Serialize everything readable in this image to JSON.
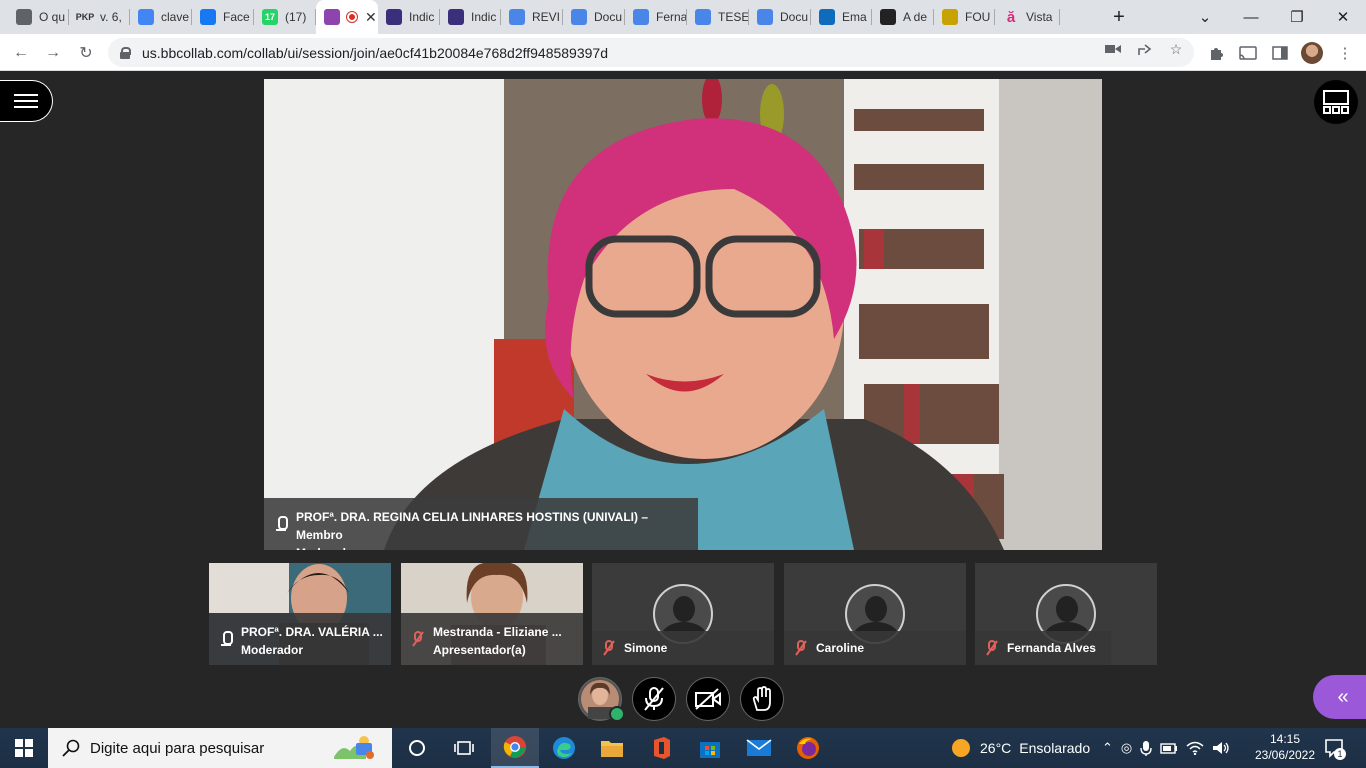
{
  "browser": {
    "tabs": [
      {
        "label": "O qu",
        "icon": "chrome-icon",
        "color": "#5f6368"
      },
      {
        "label": "v. 6,",
        "icon": "pkp-icon",
        "badge": "PKP",
        "color": "#333333"
      },
      {
        "label": "clave",
        "icon": "google-icon",
        "color": "#4285f4"
      },
      {
        "label": "Face",
        "icon": "facebook-icon",
        "color": "#1877f2"
      },
      {
        "label": "(17)",
        "icon": "whatsapp-icon",
        "badge": "17",
        "color": "#25d366"
      },
      {
        "label": "",
        "icon": "collab-recording-icon",
        "color": "#8e44ad",
        "active": true
      },
      {
        "label": "Indic",
        "icon": "indicator-icon",
        "color": "#3a2f7a"
      },
      {
        "label": "Indic",
        "icon": "indicator-icon",
        "color": "#3a2f7a"
      },
      {
        "label": "REVI",
        "icon": "docs-icon",
        "color": "#4a86e8"
      },
      {
        "label": "Docu",
        "icon": "docs-icon",
        "color": "#4a86e8"
      },
      {
        "label": "Ferna",
        "icon": "docs-icon",
        "color": "#4a86e8"
      },
      {
        "label": "TESE",
        "icon": "docs-icon",
        "color": "#4a86e8"
      },
      {
        "label": "Docu",
        "icon": "docs-icon",
        "color": "#4a86e8"
      },
      {
        "label": "Ema",
        "icon": "outlook-icon",
        "color": "#0f6cbd"
      },
      {
        "label": "A de",
        "icon": "book-icon",
        "color": "#222222"
      },
      {
        "label": "FOU",
        "icon": "crest-icon",
        "color": "#c8a200"
      },
      {
        "label": "Vista",
        "icon": "a-letter-icon",
        "badge": "ă",
        "color": "#d62d7a"
      }
    ],
    "new_tab_label": "+",
    "url": "us.bbcollab.com/collab/ui/session/join/ae0cf41b20084e768d2ff948589397d"
  },
  "session": {
    "main_speaker": {
      "name": "PROFª. DRA. REGINA CELIA LINHARES HOSTINS (UNIVALI) – Membro",
      "role": "Moderador",
      "mic": "on"
    },
    "participants": [
      {
        "name": "PROFª. DRA. VALÉRIA ...",
        "role": "Moderador",
        "mic": "on",
        "video": true
      },
      {
        "name": "Mestranda - Eliziane ...",
        "role": "Apresentador(a)",
        "mic": "off",
        "video": true
      },
      {
        "name": "Simone",
        "role": "",
        "mic": "off",
        "video": false
      },
      {
        "name": "Caroline",
        "role": "",
        "mic": "off",
        "video": false
      },
      {
        "name": "Fernanda Alves",
        "role": "",
        "mic": "off",
        "video": false
      }
    ],
    "controls": [
      "my-status",
      "microphone-off",
      "camera-off",
      "raise-hand"
    ],
    "accent_color": "#9b59d9"
  },
  "taskbar": {
    "search_placeholder": "Digite aqui para pesquisar",
    "weather_temp": "26°C",
    "weather_text": "Ensolarado",
    "time": "14:15",
    "date": "23/06/2022",
    "notifications": "1"
  }
}
